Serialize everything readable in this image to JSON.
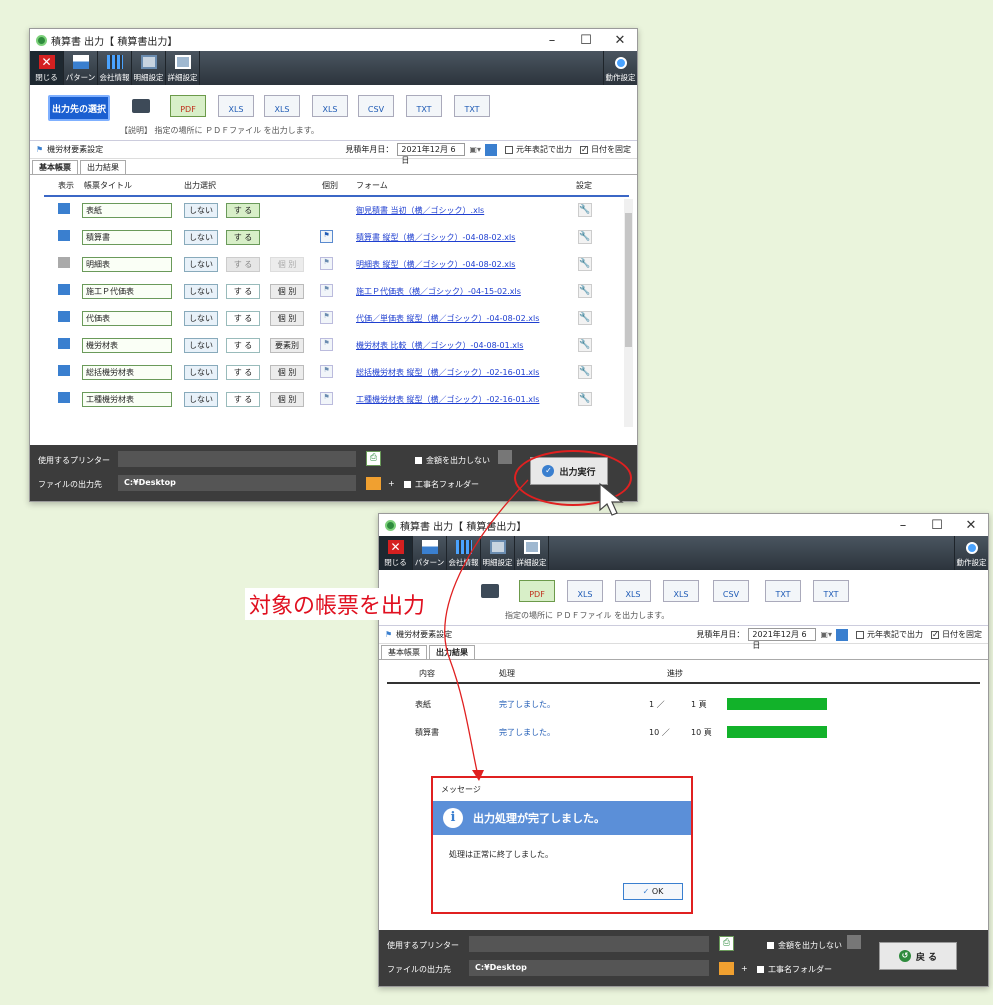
{
  "win1": {
    "title": "積算書 出力【 積算書出力】",
    "toolbar": {
      "close": "閉じる",
      "pattern": "パターン",
      "company": "会社情報",
      "detail": "明細設定",
      "detail2": "詳細設定",
      "action": "動作設定"
    },
    "output": {
      "select_label": "出力先の選択",
      "formats": [
        "PDF",
        "XLS",
        "XLS",
        "XLS",
        "CSV",
        "TXT",
        "TXT"
      ],
      "description": "【説明】 指定の場所に ＰＤＦファイル を出力します。"
    },
    "settings": {
      "label": "機労材要素設定",
      "date_label": "見積年月日：",
      "date_value": "2021年12月  6日",
      "era_label": "元年表記で出力",
      "fix_date_label": "日付を固定"
    },
    "tabs": [
      "基本帳票",
      "出力結果"
    ],
    "columns": {
      "show": "表示",
      "title": "帳票タイトル",
      "select": "出力選択",
      "individual": "個別",
      "form": "フォーム",
      "setting": "設定"
    },
    "rows": [
      {
        "title": "表紙",
        "no": "しない",
        "yes": "す る",
        "ind": "",
        "form": "御見積書 当初（横／ゴシック）.xls"
      },
      {
        "title": "積算書",
        "no": "しない",
        "yes": "す る",
        "ind": "",
        "form": "積算書 縦型（横／ゴシック）-04-08-02.xls"
      },
      {
        "title": "明細表",
        "no": "しない",
        "yes": "す る",
        "ind": "個 別",
        "form": "明細表 縦型（横／ゴシック）-04-08-02.xls"
      },
      {
        "title": "施工Ｐ代価表",
        "no": "しない",
        "yes": "す る",
        "ind": "個 別",
        "form": "施工Ｐ代価表（横／ゴシック）-04-15-02.xls"
      },
      {
        "title": "代価表",
        "no": "しない",
        "yes": "す る",
        "ind": "個 別",
        "form": "代価／単価表 縦型（横／ゴシック）-04-08-02.xls"
      },
      {
        "title": "機労材表",
        "no": "しない",
        "yes": "す る",
        "ind": "要素別",
        "form": "機労材表 比較（横／ゴシック）-04-08-01.xls"
      },
      {
        "title": "総括機労材表",
        "no": "しない",
        "yes": "す る",
        "ind": "個 別",
        "form": "総括機労材表 縦型（横／ゴシック）-02-16-01.xls"
      },
      {
        "title": "工種機労材表",
        "no": "しない",
        "yes": "す る",
        "ind": "個 別",
        "form": "工種機労材表 縦型（横／ゴシック）-02-16-01.xls"
      }
    ],
    "bottom": {
      "printer_label": "使用するプリンター",
      "dest_label": "ファイルの出力先",
      "dest_value": "C:¥Desktop",
      "no_amount": "金額を出力しない",
      "folder": "工事名フォルダー",
      "plus": "+",
      "exec": "出力実行"
    }
  },
  "win2": {
    "title": "積算書 出力【 積算書出力】",
    "description": "指定の場所に ＰＤＦファイル を出力します。",
    "progress_columns": {
      "content": "内容",
      "process": "処理",
      "progress": "進捗"
    },
    "progress_rows": [
      {
        "name": "表紙",
        "status": "完了しました。",
        "count": "1 ／",
        "pages": "1 頁",
        "fraction": 1.0
      },
      {
        "name": "積算書",
        "status": "完了しました。",
        "count": "10 ／",
        "pages": "10 頁",
        "fraction": 1.0
      }
    ],
    "dialog": {
      "title": "メッセージ",
      "heading": "出力処理が完了しました。",
      "body": "処理は正常に終了しました。",
      "ok": "OK"
    },
    "back": "戻 る"
  },
  "callout": "対象の帳票を出力",
  "colors": {
    "accent": "#1a5fd1",
    "highlight": "#e01020",
    "progress": "#12b22a",
    "toolbar": "#2c343c"
  }
}
